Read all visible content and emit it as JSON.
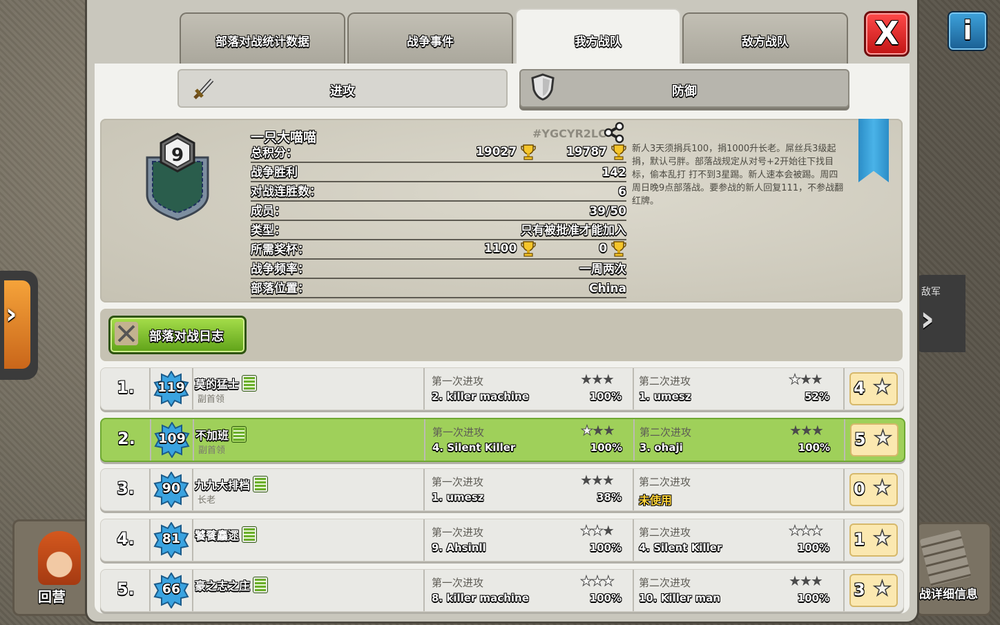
{
  "tabs": [
    "部落对战统计数据",
    "战争事件",
    "我方战队",
    "敌方战队"
  ],
  "close_label": "X",
  "info_label": "i",
  "subtabs": {
    "attack": "进攻",
    "defense": "防御"
  },
  "side": {
    "return": "回营",
    "enemy": "敌军",
    "details": "战详细信息",
    "left_arrow": "›",
    "right_arrow": "›"
  },
  "clan": {
    "name": "一只大喵喵",
    "tag": "#YGCYR2LC",
    "level": "9",
    "labels": {
      "total_points": "总积分：",
      "war_wins": "战争胜利",
      "win_streak": "对战连胜数：",
      "members": "成员：",
      "type": "类型：",
      "required_trophies": "所需奖杯：",
      "war_frequency": "战争频率：",
      "location": "部落位置："
    },
    "total_points_1": "19027",
    "total_points_2": "19787",
    "war_wins": "142",
    "win_streak": "6",
    "members": "39/50",
    "type": "只有被批准才能加入",
    "required_trophies_1": "1100",
    "required_trophies_2": "0",
    "war_frequency": "一周两次",
    "location": "China",
    "description": "新人3天须捐兵100，捐1000升长老。屌丝兵3级起捐，默认弓胖。部落战规定从对号+2开始往下找目标，偷本乱打 打不到3星踢。新人速本会被踢。周四 周日晚9点部落战。要参战的新人回复111，不参战翻红牌。"
  },
  "war_log_label": "部落对战日志",
  "attack_titles": {
    "first": "第一次进攻",
    "second": "第二次进攻"
  },
  "members": [
    {
      "rank": "1.",
      "level": "119",
      "name": "莫的猛士",
      "role": "副首领",
      "a1_target": "2. killer machine",
      "a1_pct": "100%",
      "a1_stars": 3,
      "a2_target": "1. umesz",
      "a2_pct": "52%",
      "a2_stars": 2,
      "a2_unused": "",
      "total": "4"
    },
    {
      "rank": "2.",
      "level": "109",
      "name": "不加班",
      "role": "副首领",
      "a1_target": "4. Silent Killer",
      "a1_pct": "100%",
      "a1_stars": 2,
      "a2_target": "3. ohaji",
      "a2_pct": "100%",
      "a2_stars": 3,
      "a2_unused": "",
      "total": "5"
    },
    {
      "rank": "3.",
      "level": "90",
      "name": "九九大排档",
      "role": "长老",
      "a1_target": "1. umesz",
      "a1_pct": "38%",
      "a1_stars": 3,
      "a2_target": "",
      "a2_pct": "",
      "a2_stars": -1,
      "a2_unused": "未使用",
      "total": "0"
    },
    {
      "rank": "4.",
      "level": "81",
      "name": "饕餮麤遝",
      "role": "",
      "a1_target": "9. Ahsinll",
      "a1_pct": "100%",
      "a1_stars": 1,
      "a2_target": "4. Silent Killer",
      "a2_pct": "100%",
      "a2_stars": 0,
      "a2_unused": "",
      "total": "1"
    },
    {
      "rank": "5.",
      "level": "66",
      "name": "豪之志之庄",
      "role": "",
      "a1_target": "8. killer machine",
      "a1_pct": "100%",
      "a1_stars": 0,
      "a2_target": "10. Killer man",
      "a2_pct": "100%",
      "a2_stars": 3,
      "a2_unused": "",
      "total": "3"
    }
  ],
  "colors": {
    "highlight_row": "#9fd05a",
    "close_red": "#e02020",
    "log_green": "#7bbf2c"
  }
}
